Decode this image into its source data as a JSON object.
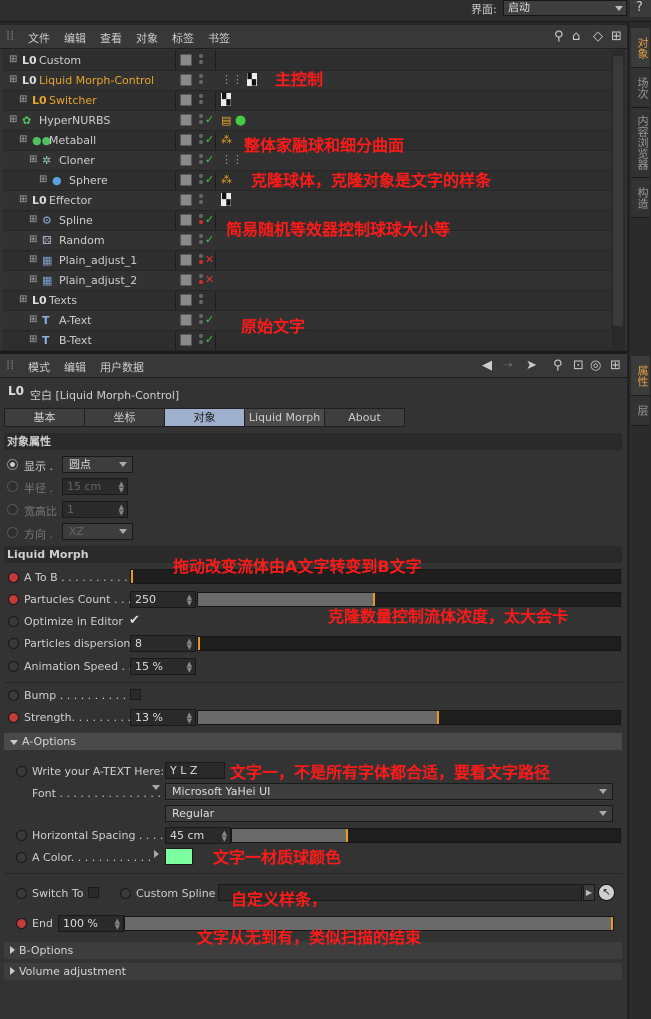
{
  "topbar": {
    "label": "界面:",
    "value": "启动"
  },
  "right_tabs_top": [
    "对象",
    "场次",
    "内容浏览器",
    "构造"
  ],
  "right_tabs_bottom": [
    "属性",
    "层"
  ],
  "om_menu": [
    "文件",
    "编辑",
    "查看",
    "对象",
    "标签",
    "书签"
  ],
  "objects": [
    {
      "name": "Custom",
      "orange": false
    },
    {
      "name": "Liquid Morph-Control",
      "orange": true
    },
    {
      "name": "Switcher",
      "orange": true
    },
    {
      "name": "HyperNURBS",
      "orange": false
    },
    {
      "name": "Metaball",
      "orange": false
    },
    {
      "name": "Cloner",
      "orange": false
    },
    {
      "name": "Sphere",
      "orange": false
    },
    {
      "name": "Effector",
      "orange": false
    },
    {
      "name": "Spline",
      "orange": false
    },
    {
      "name": "Random",
      "orange": false
    },
    {
      "name": "Plain_adjust_1",
      "orange": false
    },
    {
      "name": "Plain_adjust_2",
      "orange": false
    },
    {
      "name": "Texts",
      "orange": false
    },
    {
      "name": "A-Text",
      "orange": false
    },
    {
      "name": "B-Text",
      "orange": false
    }
  ],
  "om_annotations": [
    "主控制",
    "整体家融球和细分曲面",
    "克隆球体，克隆对象是文字的样条",
    "简易随机等效器控制球球大小等",
    "原始文字"
  ],
  "am_menu": [
    "模式",
    "编辑",
    "用户数据"
  ],
  "am_title": "空白 [Liquid Morph-Control]",
  "tabs": [
    "基本",
    "坐标",
    "对象",
    "Liquid Morph",
    "About"
  ],
  "active_tab": "对象",
  "obj_props": {
    "section": "对象属性",
    "display_label": "显示 .",
    "display_value": "圆点",
    "radius_label": "半径 .",
    "radius_value": "15 cm",
    "ratio_label": "宽高比",
    "ratio_value": "1",
    "orient_label": "方向 .",
    "orient_value": "XZ"
  },
  "liquid": {
    "section": "Liquid Morph",
    "a_to_b_label": "A To B . . . . . . . . . . .",
    "a_to_b": 0,
    "count_label": "Partucles Count . . .",
    "count_value": "250",
    "count_fill": 0.42,
    "optimize_label": "Optimize in Editor",
    "optimize_check": "✔",
    "dispersion_label": "Particles dispersion",
    "dispersion_value": "8",
    "dispersion_fill": 0,
    "speed_label": "Animation Speed . .",
    "speed_value": "15 %",
    "bump_label": "Bump . . . . . . . . . . . .",
    "strength_label": "Strength. . . . . . . . . .",
    "strength_value": "13 %",
    "strength_fill": 0.57
  },
  "liquid_annotations": [
    "拖动改变流体由A文字转变到B文字",
    "克隆数量控制流体浓度，太大会卡"
  ],
  "a_options": {
    "header": "A-Options",
    "text_label": "Write your A-TEXT Here:",
    "text_value": "Y L Z",
    "font_label": "Font . . . . . . . . . . . . . . .",
    "font_value": "Microsoft YaHei UI",
    "style_value": "Regular",
    "spacing_label": "Horizontal Spacing . . . .",
    "spacing_value": "45 cm",
    "spacing_fill": 0.3,
    "color_label": "A Color. . . . . . . . . . . .",
    "color": "#7dffa0",
    "switch_label": "Switch To",
    "spline_label": "Custom Spline",
    "end_label": "End",
    "end_value": "100 %",
    "end_fill": 1.0
  },
  "a_annotations": [
    "文字一，不是所有字体都合适，要看文字路径",
    "文字一材质球颜色",
    "自定义样条，",
    "文字从无到有，类似扫描的结束"
  ],
  "b_options": "B-Options",
  "volume": "Volume adjustment",
  "colors": {
    "accent": "#e8a42c",
    "annotation": "#ff1a1a",
    "tab_active": "#9fb0cf"
  }
}
